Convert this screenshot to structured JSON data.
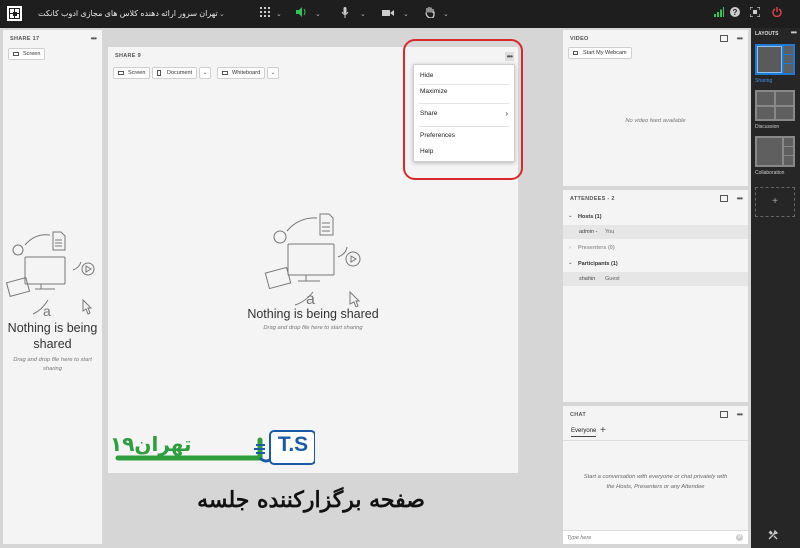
{
  "topbar": {
    "meeting_title": "تهران سرور ارائه دهنده کلاس های مجازی ادوب کانکت",
    "icons": [
      "app-logo-icon",
      "grid-icon",
      "speaker-icon",
      "microphone-icon",
      "camera-icon",
      "raise-hand-icon",
      "signal-icon",
      "help-icon",
      "fullscreen-icon",
      "power-icon"
    ],
    "colors": {
      "background": "#1e1e1e",
      "speaker": "#35c35a",
      "power": "#e24444"
    }
  },
  "left_share": {
    "header": "SHARE 17",
    "screen_button": "Screen",
    "empty_title": "Nothing is being shared",
    "empty_hint": "Drag and drop file here to start sharing"
  },
  "center_share": {
    "header": "SHARE 9",
    "buttons": {
      "screen": "Screen",
      "document": "Document",
      "whiteboard": "Whiteboard"
    },
    "empty_title": "Nothing is being shared",
    "empty_hint": "Drag and drop file here to start sharing",
    "menu": {
      "hide": "Hide",
      "maximize": "Maximize",
      "share": "Share",
      "preferences": "Preferences",
      "help": "Help"
    }
  },
  "video": {
    "header": "VIDEO",
    "start_webcam": "Start My Webcam",
    "no_feed": "No video feed available"
  },
  "attendees": {
    "header": "ATTENDEES - 2",
    "hosts_label": "Hosts (1)",
    "host": {
      "name": "admin -",
      "role": "You"
    },
    "presenters_label": "Presenters (0)",
    "participants_label": "Participants (1)",
    "participant": {
      "name": "shahin",
      "role": "Guest"
    }
  },
  "chat": {
    "header": "CHAT",
    "tab": "Everyone",
    "add": "+",
    "placeholder_text": "Start a conversation with everyone or chat privately with the Hosts, Presenters or any Attendee",
    "input_placeholder": "Type here"
  },
  "layouts": {
    "header": "LAYOUTS",
    "items": [
      "Sharing",
      "Discussion",
      "Collaboration"
    ],
    "add": "+",
    "active_color": "#1f7ad6"
  },
  "overlay": {
    "brand_latin": "T.S",
    "brand_persian": "تهران۱۹",
    "caption": "صفحه برگزارکننده جلسه",
    "colors": {
      "brand_blue": "#1a5aa6",
      "brand_green": "#2e9e3e",
      "highlight": "#d8282a"
    }
  }
}
